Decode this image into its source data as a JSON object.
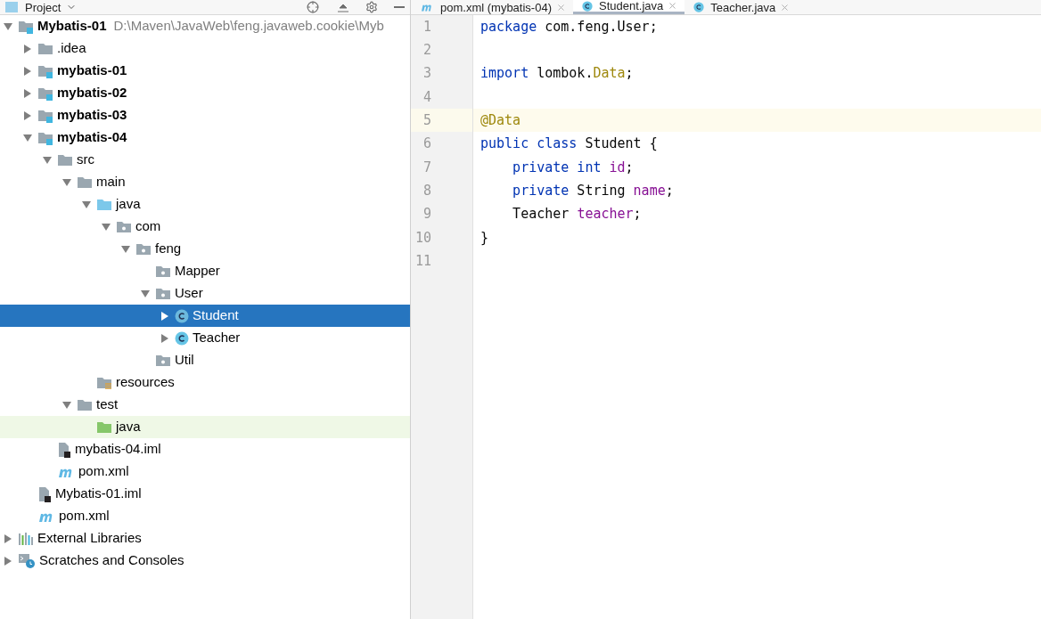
{
  "project_panel": {
    "title": "Project"
  },
  "tree": [
    {
      "label": "Mybatis-01",
      "path": "D:\\Maven\\JavaWeb\\feng.javaweb.cookie\\Myb",
      "kind": "module",
      "bold": true,
      "expanded": true,
      "selected": false,
      "children": [
        {
          "label": ".idea",
          "kind": "folder",
          "bold": false,
          "expanded": false,
          "selected": false
        },
        {
          "label": "mybatis-01",
          "kind": "module",
          "bold": true,
          "expanded": false,
          "selected": false
        },
        {
          "label": "mybatis-02",
          "kind": "module",
          "bold": true,
          "expanded": false,
          "selected": false
        },
        {
          "label": "mybatis-03",
          "kind": "module",
          "bold": true,
          "expanded": false,
          "selected": false
        },
        {
          "label": "mybatis-04",
          "kind": "module",
          "bold": true,
          "expanded": true,
          "selected": false,
          "children": [
            {
              "label": "src",
              "kind": "folder",
              "bold": false,
              "expanded": true,
              "selected": false,
              "children": [
                {
                  "label": "main",
                  "kind": "folder",
                  "bold": false,
                  "expanded": true,
                  "selected": false,
                  "children": [
                    {
                      "label": "java",
                      "kind": "source",
                      "bold": false,
                      "expanded": true,
                      "selected": false,
                      "children": [
                        {
                          "label": "com",
                          "kind": "package",
                          "bold": false,
                          "expanded": true,
                          "selected": false,
                          "children": [
                            {
                              "label": "feng",
                              "kind": "package",
                              "bold": false,
                              "expanded": true,
                              "selected": false,
                              "children": [
                                {
                                  "label": "Mapper",
                                  "kind": "package",
                                  "bold": false,
                                  "selected": false
                                },
                                {
                                  "label": "User",
                                  "kind": "package",
                                  "bold": false,
                                  "expanded": true,
                                  "selected": false,
                                  "children": [
                                    {
                                      "label": "Student",
                                      "kind": "class",
                                      "bold": false,
                                      "expanded": false,
                                      "selected": true
                                    },
                                    {
                                      "label": "Teacher",
                                      "kind": "class",
                                      "bold": false,
                                      "expanded": false,
                                      "selected": false
                                    }
                                  ]
                                },
                                {
                                  "label": "Util",
                                  "kind": "package",
                                  "bold": false,
                                  "selected": false
                                }
                              ]
                            }
                          ]
                        }
                      ]
                    },
                    {
                      "label": "resources",
                      "kind": "resources",
                      "bold": false,
                      "selected": false
                    }
                  ]
                },
                {
                  "label": "test",
                  "kind": "folder",
                  "bold": false,
                  "expanded": true,
                  "selected": false,
                  "children": [
                    {
                      "label": "java",
                      "kind": "test",
                      "bold": false,
                      "selected": false
                    }
                  ]
                }
              ]
            },
            {
              "label": "mybatis-04.iml",
              "kind": "iml",
              "bold": false,
              "selected": false
            },
            {
              "label": "pom.xml",
              "kind": "maven",
              "bold": false,
              "selected": false
            }
          ]
        },
        {
          "label": "Mybatis-01.iml",
          "kind": "iml",
          "bold": false,
          "selected": false
        },
        {
          "label": "pom.xml",
          "kind": "maven",
          "bold": false,
          "selected": false
        }
      ]
    },
    {
      "label": "External Libraries",
      "kind": "libraries",
      "bold": false,
      "expanded": false,
      "selected": false
    },
    {
      "label": "Scratches and Consoles",
      "kind": "scratches",
      "bold": false,
      "expanded": false,
      "selected": false
    }
  ],
  "tabs": [
    {
      "label": "pom.xml (mybatis-04)",
      "kind": "maven",
      "selected": false
    },
    {
      "label": "Student.java",
      "kind": "class",
      "selected": true
    },
    {
      "label": "Teacher.java",
      "kind": "class",
      "selected": false
    }
  ],
  "editor": {
    "lines": [
      {
        "number": "1",
        "current": false,
        "tokens": [
          {
            "text": "package",
            "kind": "keyword"
          },
          {
            "text": " com.feng.User;",
            "kind": "plain"
          }
        ]
      },
      {
        "number": "2",
        "current": false
      },
      {
        "number": "3",
        "current": false,
        "tokens": [
          {
            "text": "import",
            "kind": "keyword"
          },
          {
            "text": " lombok.",
            "kind": "plain"
          },
          {
            "text": "Data",
            "kind": "annotation"
          },
          {
            "text": ";",
            "kind": "plain"
          }
        ]
      },
      {
        "number": "4",
        "current": false
      },
      {
        "number": "5",
        "current": true,
        "tokens": [
          {
            "text": "@Data",
            "kind": "annotation"
          }
        ]
      },
      {
        "number": "6",
        "current": false,
        "tokens": [
          {
            "text": "public class",
            "kind": "keyword"
          },
          {
            "text": " Student {",
            "kind": "plain"
          }
        ]
      },
      {
        "number": "7",
        "current": false,
        "tokens": [
          {
            "text": "    private int",
            "kind": "keyword"
          },
          {
            "text": " id",
            "kind": "field"
          },
          {
            "text": ";",
            "kind": "plain"
          }
        ]
      },
      {
        "number": "8",
        "current": false,
        "tokens": [
          {
            "text": "    private",
            "kind": "keyword"
          },
          {
            "text": " String ",
            "kind": "plain"
          },
          {
            "text": "name",
            "kind": "field"
          },
          {
            "text": ";",
            "kind": "plain"
          }
        ]
      },
      {
        "number": "9",
        "current": false,
        "tokens": [
          {
            "text": "    Teacher ",
            "kind": "plain"
          },
          {
            "text": "teacher",
            "kind": "field"
          },
          {
            "text": ";",
            "kind": "plain"
          }
        ]
      },
      {
        "number": "10",
        "current": false,
        "tokens": [
          {
            "text": "}",
            "kind": "plain"
          }
        ]
      },
      {
        "number": "11",
        "current": false
      }
    ]
  }
}
